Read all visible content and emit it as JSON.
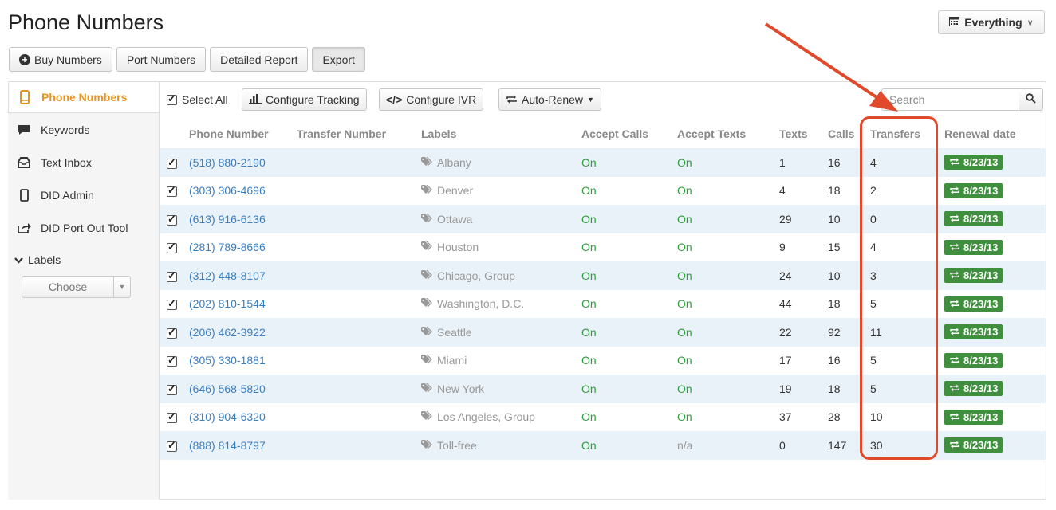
{
  "page": {
    "title": "Phone Numbers"
  },
  "range_selector": {
    "label": "Everything",
    "icon": "calendar-icon"
  },
  "top_actions": [
    {
      "name": "buy-numbers-button",
      "label": "Buy Numbers",
      "icon": "plus-circle-icon"
    },
    {
      "name": "port-numbers-button",
      "label": "Port Numbers"
    },
    {
      "name": "detailed-report-button",
      "label": "Detailed Report"
    },
    {
      "name": "export-button",
      "label": "Export"
    }
  ],
  "sidebar": {
    "items": [
      {
        "label": "Phone Numbers",
        "icon": "phone-icon",
        "active": true
      },
      {
        "label": "Keywords",
        "icon": "speech-bubble-icon"
      },
      {
        "label": "Text Inbox",
        "icon": "inbox-icon"
      },
      {
        "label": "DID Admin",
        "icon": "mobile-icon"
      },
      {
        "label": "DID Port Out Tool",
        "icon": "share-icon"
      }
    ],
    "labels_heading": "Labels",
    "labels_select": "Choose"
  },
  "toolbar": {
    "select_all": "Select All",
    "configure_tracking": "Configure Tracking",
    "configure_ivr": "Configure IVR",
    "auto_renew": "Auto-Renew",
    "search_placeholder": "Search"
  },
  "table": {
    "headers": [
      "Phone Number",
      "Transfer Number",
      "Labels",
      "Accept Calls",
      "Accept Texts",
      "Texts",
      "Calls",
      "Transfers",
      "Renewal date"
    ],
    "rows": [
      {
        "phone": "(518) 880-2190",
        "transfer": "",
        "label": "Albany",
        "accept_calls": "On",
        "accept_texts": "On",
        "texts": "1",
        "calls": "16",
        "transfers": "4",
        "renewal": "8/23/13"
      },
      {
        "phone": "(303) 306-4696",
        "transfer": "",
        "label": "Denver",
        "accept_calls": "On",
        "accept_texts": "On",
        "texts": "4",
        "calls": "18",
        "transfers": "2",
        "renewal": "8/23/13"
      },
      {
        "phone": "(613) 916-6136",
        "transfer": "",
        "label": "Ottawa",
        "accept_calls": "On",
        "accept_texts": "On",
        "texts": "29",
        "calls": "10",
        "transfers": "0",
        "renewal": "8/23/13"
      },
      {
        "phone": "(281) 789-8666",
        "transfer": "",
        "label": "Houston",
        "accept_calls": "On",
        "accept_texts": "On",
        "texts": "9",
        "calls": "15",
        "transfers": "4",
        "renewal": "8/23/13"
      },
      {
        "phone": "(312) 448-8107",
        "transfer": "",
        "label": "Chicago, Group",
        "accept_calls": "On",
        "accept_texts": "On",
        "texts": "24",
        "calls": "10",
        "transfers": "3",
        "renewal": "8/23/13"
      },
      {
        "phone": "(202) 810-1544",
        "transfer": "",
        "label": "Washington, D.C.",
        "accept_calls": "On",
        "accept_texts": "On",
        "texts": "44",
        "calls": "18",
        "transfers": "5",
        "renewal": "8/23/13"
      },
      {
        "phone": "(206) 462-3922",
        "transfer": "",
        "label": "Seattle",
        "accept_calls": "On",
        "accept_texts": "On",
        "texts": "22",
        "calls": "92",
        "transfers": "11",
        "renewal": "8/23/13"
      },
      {
        "phone": "(305) 330-1881",
        "transfer": "",
        "label": "Miami",
        "accept_calls": "On",
        "accept_texts": "On",
        "texts": "17",
        "calls": "16",
        "transfers": "5",
        "renewal": "8/23/13"
      },
      {
        "phone": "(646) 568-5820",
        "transfer": "",
        "label": "New York",
        "accept_calls": "On",
        "accept_texts": "On",
        "texts": "19",
        "calls": "18",
        "transfers": "5",
        "renewal": "8/23/13"
      },
      {
        "phone": "(310) 904-6320",
        "transfer": "",
        "label": "Los Angeles, Group",
        "accept_calls": "On",
        "accept_texts": "On",
        "texts": "37",
        "calls": "28",
        "transfers": "10",
        "renewal": "8/23/13"
      },
      {
        "phone": "(888) 814-8797",
        "transfer": "",
        "label": "Toll-free",
        "accept_calls": "On",
        "accept_texts": "n/a",
        "texts": "0",
        "calls": "147",
        "transfers": "30",
        "renewal": "8/23/13"
      }
    ]
  },
  "colors": {
    "accent_orange": "#e8941a",
    "link_blue": "#3a7fc0",
    "on_green": "#2f9c3e",
    "renew_green": "#3f8f3e",
    "annotation_red": "#e04a2b",
    "row_stripe": "#eaf2f9"
  }
}
